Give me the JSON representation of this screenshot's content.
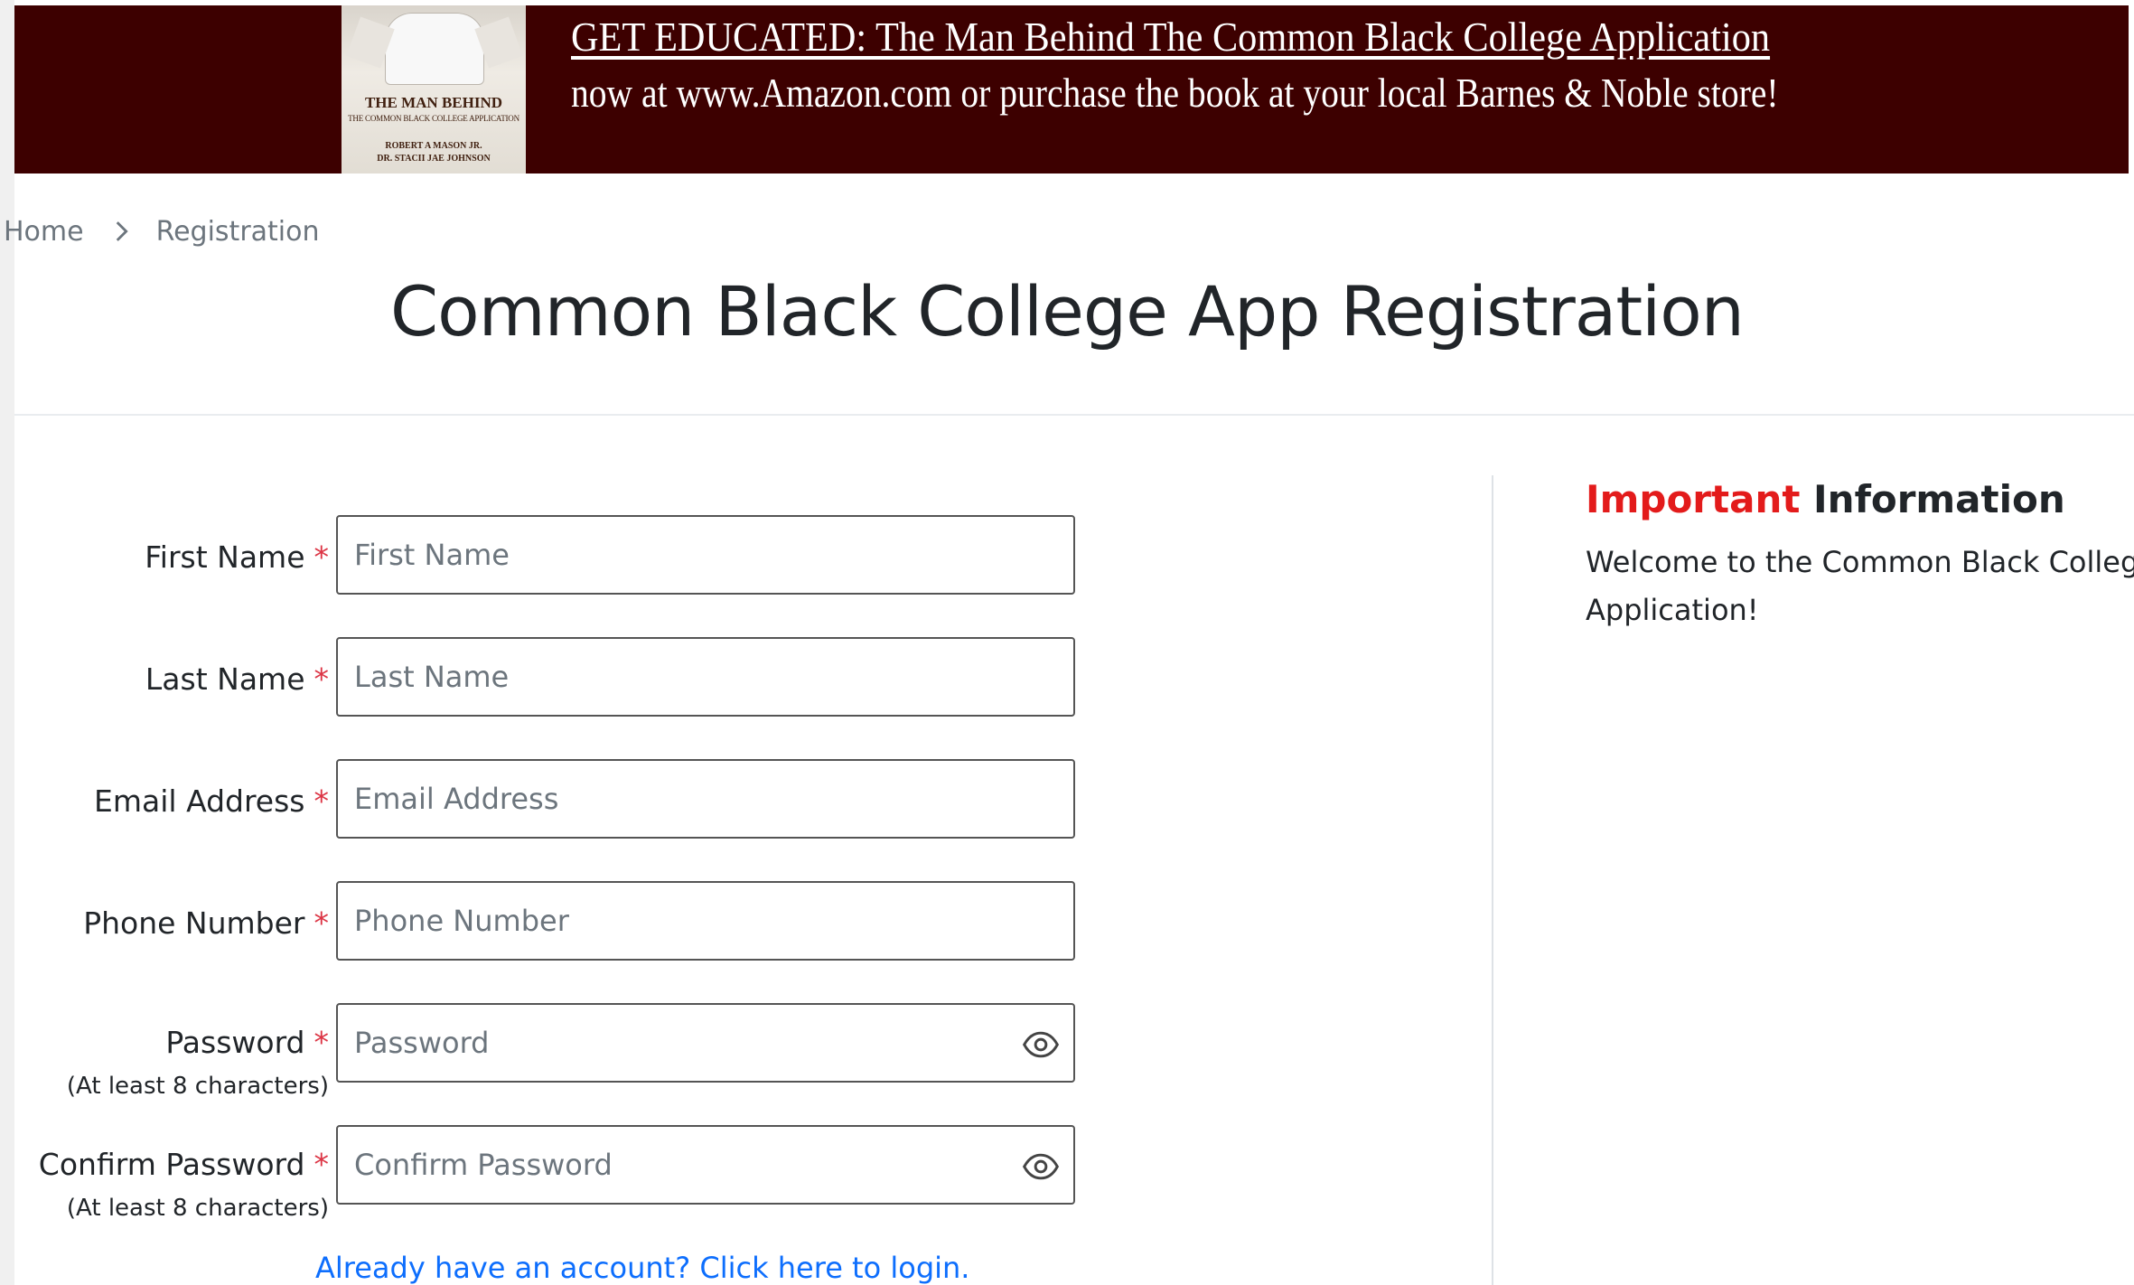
{
  "banner": {
    "book": {
      "title": "THE MAN BEHIND",
      "subtitle": "THE COMMON BLACK COLLEGE APPLICATION",
      "author1": "ROBERT A MASON JR.",
      "author2": "DR. STACII JAE JOHNSON"
    },
    "headline": "GET EDUCATED: The Man Behind The Common Black College Application",
    "subline": "now at www.Amazon.com or purchase the book at your local Barnes & Noble store!",
    "background_color": "#3d0000"
  },
  "breadcrumb": {
    "home": "Home",
    "current": "Registration",
    "separator_icon": "chevron-right-icon"
  },
  "page": {
    "title": "Common Black College App Registration"
  },
  "form": {
    "required_mark": "*",
    "fields": [
      {
        "label": "First Name",
        "placeholder": "First Name",
        "value": "",
        "type": "text"
      },
      {
        "label": "Last Name",
        "placeholder": "Last Name",
        "value": "",
        "type": "text"
      },
      {
        "label": "Email Address",
        "placeholder": "Email Address",
        "value": "",
        "type": "email"
      },
      {
        "label": "Phone Number",
        "placeholder": "Phone Number",
        "value": "",
        "type": "tel"
      },
      {
        "label": "Password",
        "hint": "(At least 8 characters)",
        "placeholder": "Password",
        "value": "",
        "type": "password",
        "icon": "eye-icon"
      },
      {
        "label": "Confirm Password",
        "hint": "(At least 8 characters)",
        "placeholder": "Confirm Password",
        "value": "",
        "type": "password",
        "icon": "eye-icon"
      }
    ],
    "login_link": "Already have an account? Click here to login."
  },
  "info": {
    "title_accent": "Important",
    "title_rest": "Information",
    "accent_color": "#e31b1b",
    "text": "Welcome to the Common Black College Application!"
  }
}
